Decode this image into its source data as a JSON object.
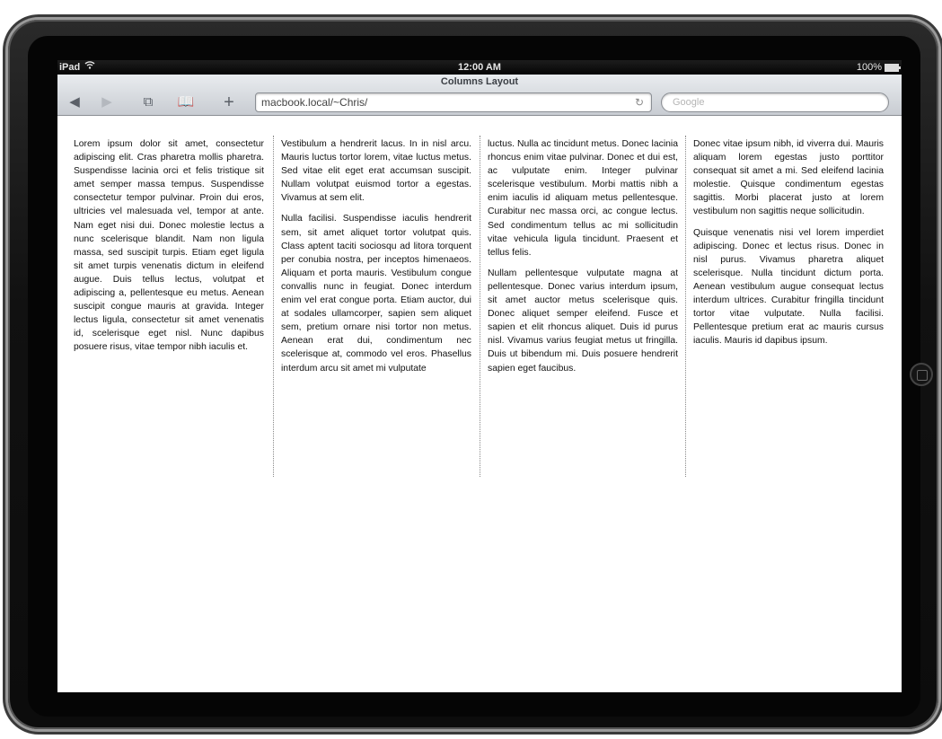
{
  "status_bar": {
    "carrier": "iPad",
    "wifi_icon": "wifi-icon",
    "time": "12:00 AM",
    "battery": "100%",
    "battery_icon": "battery-full-icon"
  },
  "browser": {
    "page_title": "Columns Layout",
    "back_icon": "◀",
    "forward_icon": "▶",
    "pages_icon": "⧉",
    "bookmarks_icon": "📖",
    "add_icon": "+",
    "url": "macbook.local/~Chris/",
    "reload_icon": "↻",
    "search_placeholder": "Google"
  },
  "content": {
    "columns": [
      {
        "paragraphs": [
          "Lorem ipsum dolor sit amet, consectetur adipiscing elit. Cras pharetra mollis pharetra. Suspendisse lacinia orci et felis tristique sit amet semper massa tempus. Suspendisse consectetur tempor pulvinar. Proin dui eros, ultricies vel malesuada vel, tempor at ante. Nam eget nisi dui. Donec molestie lectus a nunc scelerisque blandit. Nam non ligula massa, sed suscipit turpis. Etiam eget ligula sit amet turpis venenatis dictum in eleifend augue. Duis tellus lectus, volutpat et adipiscing a, pellentesque eu metus. Aenean suscipit congue mauris at gravida. Integer lectus ligula, consectetur sit amet venenatis id, scelerisque eget nisl. Nunc dapibus posuere risus, vitae tempor nibh iaculis et."
        ]
      },
      {
        "paragraphs": [
          "Vestibulum a hendrerit lacus. In in nisl arcu. Mauris luctus tortor lorem, vitae luctus metus. Sed vitae elit eget erat accumsan suscipit. Nullam volutpat euismod tortor a egestas. Vivamus at sem elit.",
          "Nulla facilisi. Suspendisse iaculis hendrerit sem, sit amet aliquet tortor volutpat quis. Class aptent taciti sociosqu ad litora torquent per conubia nostra, per inceptos himenaeos. Aliquam et porta mauris. Vestibulum congue convallis nunc in feugiat. Donec interdum enim vel erat congue porta. Etiam auctor, dui at sodales ullamcorper, sapien sem aliquet sem, pretium ornare nisi tortor non metus. Aenean erat dui, condimentum nec scelerisque at, commodo vel eros. Phasellus interdum arcu sit amet mi vulputate"
        ]
      },
      {
        "paragraphs": [
          "luctus. Nulla ac tincidunt metus. Donec lacinia rhoncus enim vitae pulvinar. Donec et dui est, ac vulputate enim. Integer pulvinar scelerisque vestibulum. Morbi mattis nibh a enim iaculis id aliquam metus pellentesque. Curabitur nec massa orci, ac congue lectus. Sed condimentum tellus ac mi sollicitudin vitae vehicula ligula tincidunt. Praesent et tellus felis.",
          "Nullam pellentesque vulputate magna at pellentesque. Donec varius interdum ipsum, sit amet auctor metus scelerisque quis. Donec aliquet semper eleifend. Fusce et sapien et elit rhoncus aliquet. Duis id purus nisl. Vivamus varius feugiat metus ut fringilla. Duis ut bibendum mi. Duis posuere hendrerit sapien eget faucibus."
        ]
      },
      {
        "paragraphs": [
          "Donec vitae ipsum nibh, id viverra dui. Mauris aliquam lorem egestas justo porttitor consequat sit amet a mi. Sed eleifend lacinia molestie. Quisque condimentum egestas sagittis. Morbi placerat justo at lorem vestibulum non sagittis neque sollicitudin.",
          "Quisque venenatis nisi vel lorem imperdiet adipiscing. Donec et lectus risus. Donec in nisl purus. Vivamus pharetra aliquet scelerisque. Nulla tincidunt dictum porta. Aenean vestibulum augue consequat lectus interdum ultrices. Curabitur fringilla tincidunt tortor vitae vulputate. Nulla facilisi. Pellentesque pretium erat ac mauris cursus iaculis. Mauris id dapibus ipsum."
        ]
      }
    ]
  }
}
